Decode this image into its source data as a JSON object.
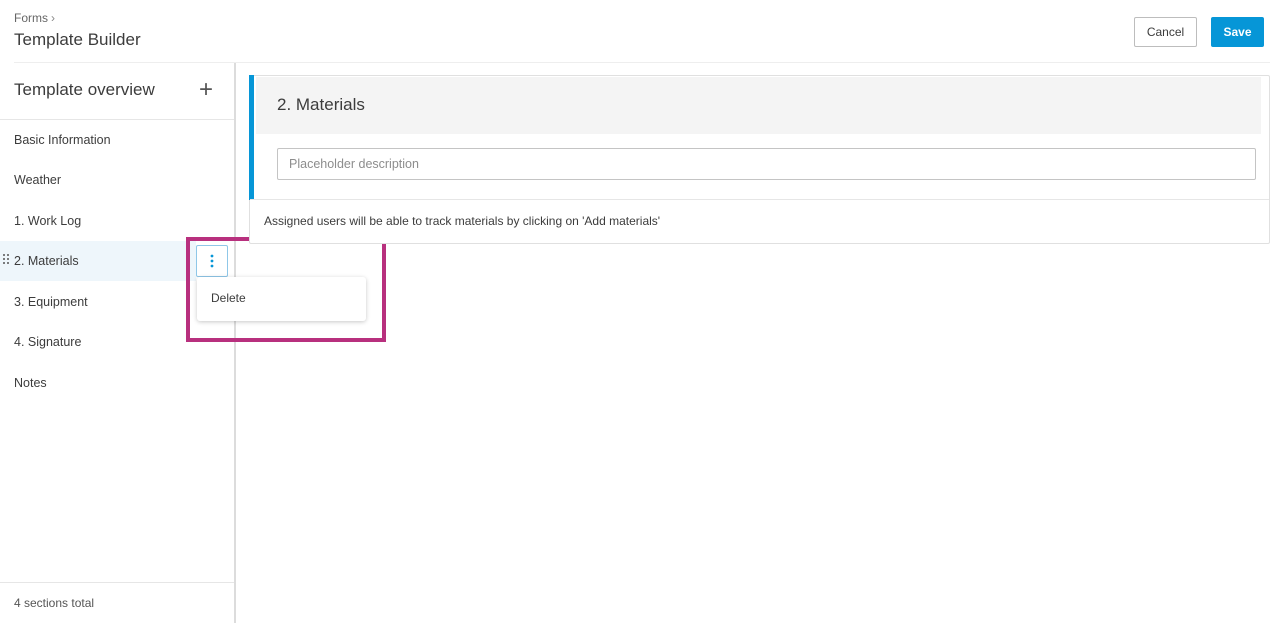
{
  "header": {
    "breadcrumb": "Forms",
    "breadcrumb_separator": "›",
    "title": "Template Builder",
    "cancel_label": "Cancel",
    "save_label": "Save"
  },
  "sidebar": {
    "title": "Template overview",
    "add_symbol": "+",
    "items": [
      {
        "label": "Basic Information"
      },
      {
        "label": "Weather"
      },
      {
        "label": "1. Work Log"
      },
      {
        "label": "2. Materials",
        "active": true
      },
      {
        "label": "3. Equipment"
      },
      {
        "label": "4. Signature"
      },
      {
        "label": "Notes"
      }
    ],
    "footer": "4 sections total"
  },
  "context_menu": {
    "items": [
      {
        "label": "Delete"
      }
    ]
  },
  "section": {
    "title": "2. Materials",
    "description_placeholder": "Placeholder description",
    "description_value": "",
    "note": "Assigned users will be able to track materials by clicking on 'Add materials'"
  },
  "icons": {
    "kebab": "more-vertical-icon",
    "drag": "drag-handle-icon",
    "add": "plus-icon"
  },
  "colors": {
    "primary": "#0696d7",
    "highlight": "#b8307e",
    "active_row": "#eef6fb"
  }
}
